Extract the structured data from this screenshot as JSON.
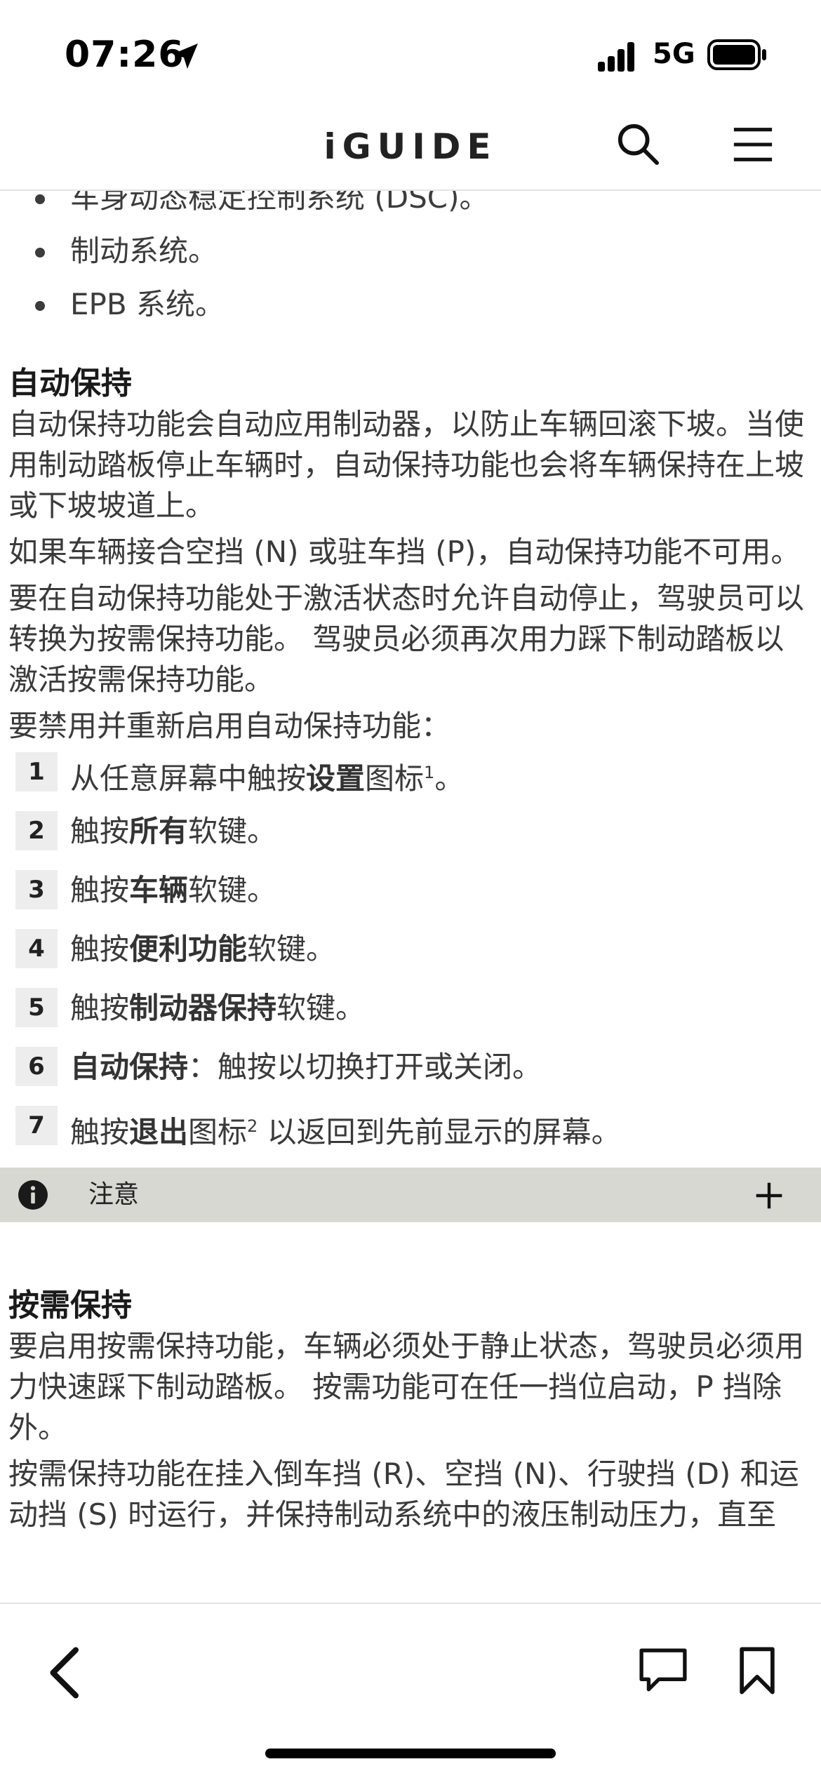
{
  "status_bar": {
    "time": "07:26",
    "network": "5G",
    "icons": [
      "location-arrow-icon",
      "signal-bars-icon",
      "battery-icon"
    ]
  },
  "header": {
    "title": "iGUIDE",
    "icons": [
      "search-icon",
      "menu-icon"
    ]
  },
  "content": {
    "bullets": [
      "车身动态稳定控制系统 (DSC)。",
      "制动系统。",
      "EPB 系统。"
    ],
    "auto_hold": {
      "heading": "自动保持",
      "p1": "自动保持功能会自动应用制动器，以防止车辆回滚下坡。当使用制动踏板停止车辆时，自动保持功能也会将车辆保持在上坡或下坡坡道上。",
      "p2": "如果车辆接合空挡 (N) 或驻车挡 (P)，自动保持功能不可用。",
      "p3": "要在自动保持功能处于激活状态时允许自动停止，驾驶员可以转换为按需保持功能。 驾驶员必须再次用力踩下制动踏板以激活按需保持功能。",
      "p4": "要禁用并重新启用自动保持功能："
    },
    "steps": [
      {
        "num": "1",
        "pre": "从任意屏幕中触按",
        "bold": "设置",
        "post": "图标",
        "sup": "1",
        "tail": "。"
      },
      {
        "num": "2",
        "pre": "触按",
        "bold": "所有",
        "post": "软键。",
        "sup": "",
        "tail": ""
      },
      {
        "num": "3",
        "pre": "触按",
        "bold": "车辆",
        "post": "软键。",
        "sup": "",
        "tail": ""
      },
      {
        "num": "4",
        "pre": "触按",
        "bold": "便利功能",
        "post": "软键。",
        "sup": "",
        "tail": ""
      },
      {
        "num": "5",
        "pre": "触按",
        "bold": "制动器保持",
        "post": "软键。",
        "sup": "",
        "tail": ""
      },
      {
        "num": "6",
        "pre": "",
        "bold": "自动保持",
        "post": "：触按以切换打开或关闭。",
        "sup": "",
        "tail": ""
      },
      {
        "num": "7",
        "pre": "触按",
        "bold": "退出",
        "post": "图标",
        "sup": "2",
        "tail": " 以返回到先前显示的屏幕。"
      }
    ],
    "note": {
      "label": "注意",
      "icons": [
        "info-icon",
        "expand-plus-icon"
      ]
    },
    "on_demand": {
      "heading": "按需保持",
      "p1": "要启用按需保持功能，车辆必须处于静止状态，驾驶员必须用力快速踩下制动踏板。 按需功能可在任一挡位启动，P 挡除外。",
      "p2": "按需保持功能在挂入倒车挡 (R)、空挡 (N)、行驶挡 (D) 和运动挡 (S) 时运行，并保持制动系统中的液压制动压力，直至"
    }
  },
  "toolbar": {
    "icons": [
      "back-chevron-icon",
      "comment-icon",
      "bookmark-icon"
    ]
  }
}
